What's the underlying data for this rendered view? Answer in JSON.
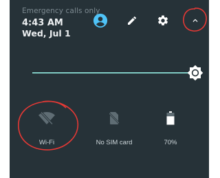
{
  "status": {
    "carrier_text": "Emergency calls only",
    "time": "4:43 AM",
    "date": "Wed, Jul 1"
  },
  "header_actions": [
    {
      "name": "user-icon",
      "color": "#4fc3f7"
    },
    {
      "name": "edit-icon",
      "color": "#ffffff"
    },
    {
      "name": "settings-icon",
      "color": "#ffffff"
    },
    {
      "name": "chevron-up-icon",
      "color": "#ffffff"
    }
  ],
  "brightness": {
    "level": 1.0,
    "track_color": "#80cbc4",
    "icon": "brightness-icon"
  },
  "tiles": [
    {
      "label": "Wi-Fi",
      "icon": "wifi-off-icon"
    },
    {
      "label": "No SIM card",
      "icon": "no-sim-icon"
    },
    {
      "label": "70%",
      "icon": "battery-icon"
    }
  ],
  "colors": {
    "panel_background": "#263238",
    "annotation": "#e53935"
  }
}
